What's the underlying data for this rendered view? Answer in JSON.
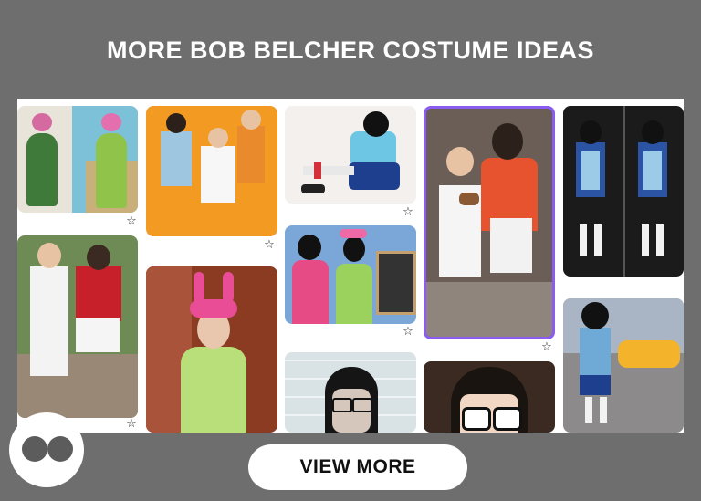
{
  "header": {
    "title": "MORE BOB BELCHER COSTUME IDEAS"
  },
  "gallery": {
    "pins": [
      {
        "name": "pin-tina-green-dress-cartoon",
        "colors": [
          "#e9e4da",
          "#3f7a3b",
          "#d46aa0"
        ]
      },
      {
        "name": "pin-bob-linda-couple",
        "colors": [
          "#6f8b55",
          "#f3f3f3",
          "#c8202a"
        ]
      },
      {
        "name": "pin-family-orange-backdrop",
        "colors": [
          "#f29a22",
          "#9fc6e0",
          "#f7f7f7"
        ]
      },
      {
        "name": "pin-louise-green-pink-ears",
        "colors": [
          "#8a3b22",
          "#b8df7a",
          "#e84d96"
        ]
      },
      {
        "name": "pin-tina-sitting",
        "colors": [
          "#f3f0ee",
          "#1d3f8d",
          "#6cc6e4"
        ]
      },
      {
        "name": "pin-louise-gene-burger-board",
        "colors": [
          "#7aa6d8",
          "#e64b86",
          "#9bd25e"
        ]
      },
      {
        "name": "pin-tina-glasses-closeup",
        "colors": [
          "#e8eef0",
          "#222222",
          "#d6c7bd"
        ]
      },
      {
        "name": "pin-bob-linda-featured",
        "colors": [
          "#6a5e57",
          "#f5f5f5",
          "#e6532e"
        ]
      },
      {
        "name": "pin-tina-cartoon-face",
        "colors": [
          "#3a2a22",
          "#f2d8c4",
          "#111111"
        ]
      },
      {
        "name": "pin-tina-night-duo",
        "colors": [
          "#1b1b1b",
          "#2b54a4",
          "#9ccbe8"
        ]
      },
      {
        "name": "pin-tina-yellow-taxi",
        "colors": [
          "#8c8a8a",
          "#f3b32a",
          "#6fa9d6"
        ]
      }
    ]
  },
  "cta": {
    "label": "VIEW MORE"
  },
  "brand": {
    "logo": "two-eyes-logo"
  },
  "icons": {
    "save": "star-icon"
  }
}
